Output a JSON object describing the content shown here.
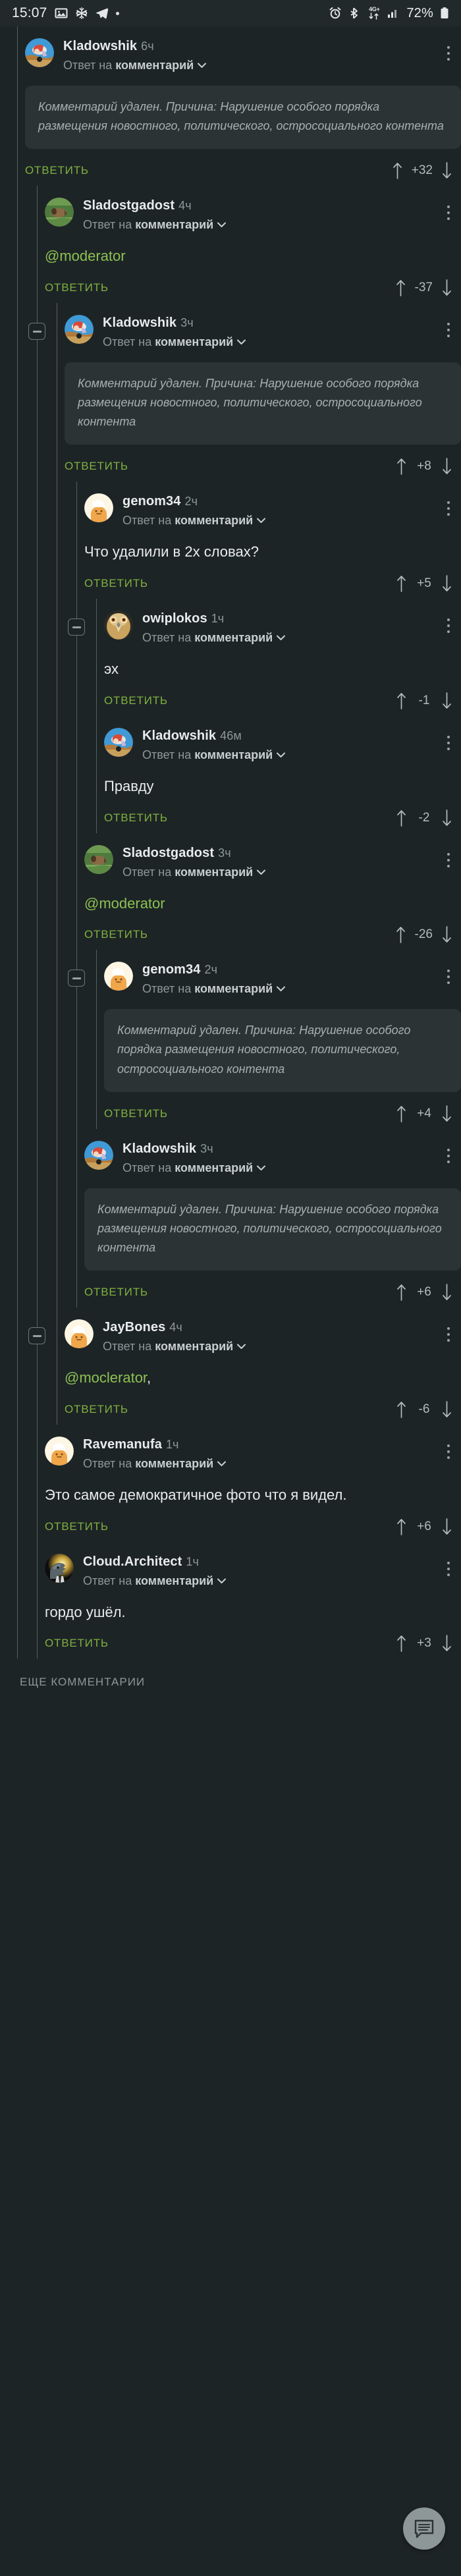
{
  "statusbar": {
    "time": "15:07",
    "battery": "72%",
    "network_label": "4G+",
    "icons": [
      "image-icon",
      "snowflake-icon",
      "telegram-icon",
      "dot-icon",
      "alarm-icon",
      "bluetooth-icon",
      "network-4g-icon",
      "signal-bars-icon",
      "battery-icon"
    ]
  },
  "labels": {
    "reply": "ОТВЕТИТЬ",
    "reply_to_prefix": "Ответ на ",
    "reply_to_link": "комментарий",
    "more_comments": "ЕЩЕ КОММЕНТАРИИ",
    "deleted_full": "Комментарий удален. Причина: Нарушение особого порядка размещения новостного, политического, остросоциального контента"
  },
  "colors": {
    "background": "#1d2426",
    "accent_green": "#7fb13f",
    "mention_green": "#8cc152",
    "deleted_bg": "#2c3335",
    "rail": "#55605f",
    "muted_text": "#8d9899",
    "primary_text": "#e9ecee"
  },
  "comments": [
    {
      "id": "c1",
      "user": "Kladowshik",
      "time": "6ч",
      "avatar": "santa-avatar",
      "depth": 0,
      "body_type": "deleted",
      "text": "Комментарий удален. Причина: Нарушение особого порядка размещения новостного, политического, остросоциального контента",
      "score": "+32",
      "collapse": false
    },
    {
      "id": "c2",
      "user": "Sladostgadost",
      "time": "4ч",
      "avatar": "dog-avatar",
      "depth": 1,
      "body_type": "mention",
      "text": "@moderator",
      "score": "-37",
      "collapse": false
    },
    {
      "id": "c3",
      "user": "Kladowshik",
      "time": "3ч",
      "avatar": "santa-avatar",
      "depth": 2,
      "body_type": "deleted",
      "text": "Комментарий удален. Причина: Нарушение особого порядка размещения новостного, политического, остросоциального контента",
      "score": "+8",
      "collapse": true
    },
    {
      "id": "c4",
      "user": "genom34",
      "time": "2ч",
      "avatar": "chef-avatar",
      "depth": 3,
      "body_type": "text",
      "text": "Что удалили в 2х словах?",
      "score": "+5",
      "collapse": false
    },
    {
      "id": "c5",
      "user": "owiplokos",
      "time": "1ч",
      "avatar": "eagle-avatar",
      "depth": 4,
      "body_type": "text",
      "text": "эх",
      "score": "-1",
      "collapse": true
    },
    {
      "id": "c6",
      "user": "Kladowshik",
      "time": "46м",
      "avatar": "santa-avatar",
      "depth": 4,
      "body_type": "text",
      "text": "Правду",
      "score": "-2",
      "collapse": false
    },
    {
      "id": "c7",
      "user": "Sladostgadost",
      "time": "3ч",
      "avatar": "dog-avatar",
      "depth": 3,
      "body_type": "mention",
      "text": "@moderator",
      "score": "-26",
      "collapse": false
    },
    {
      "id": "c8",
      "user": "genom34",
      "time": "2ч",
      "avatar": "chef-avatar",
      "depth": 4,
      "body_type": "deleted",
      "text": "Комментарий удален. Причина: Нарушение особого порядка размещения новостного, политического, остросоциального контента",
      "score": "+4",
      "collapse": true
    },
    {
      "id": "c9",
      "user": "Kladowshik",
      "time": "3ч",
      "avatar": "santa-avatar",
      "depth": 3,
      "body_type": "deleted",
      "text": "Комментарий удален. Причина: Нарушение особого порядка размещения новостного, политического, остросоциального контента",
      "score": "+6",
      "collapse": false
    },
    {
      "id": "c10",
      "user": "JayBones",
      "time": "4ч",
      "avatar": "chef-avatar",
      "depth": 2,
      "body_type": "mention",
      "text": "@moclerator",
      "text_tail": ",",
      "score": "-6",
      "collapse": true
    },
    {
      "id": "c11",
      "user": "Ravemanufa",
      "time": "1ч",
      "avatar": "chef-avatar",
      "depth": 1,
      "body_type": "text",
      "text": "Это самое демократичное фото что я видел.",
      "score": "+6",
      "collapse": false
    },
    {
      "id": "c12",
      "user": "Cloud.Architect",
      "time": "1ч",
      "avatar": "dino-avatar",
      "depth": 1,
      "body_type": "text",
      "text": "гордо ушёл.",
      "score": "+3",
      "collapse": false
    }
  ]
}
